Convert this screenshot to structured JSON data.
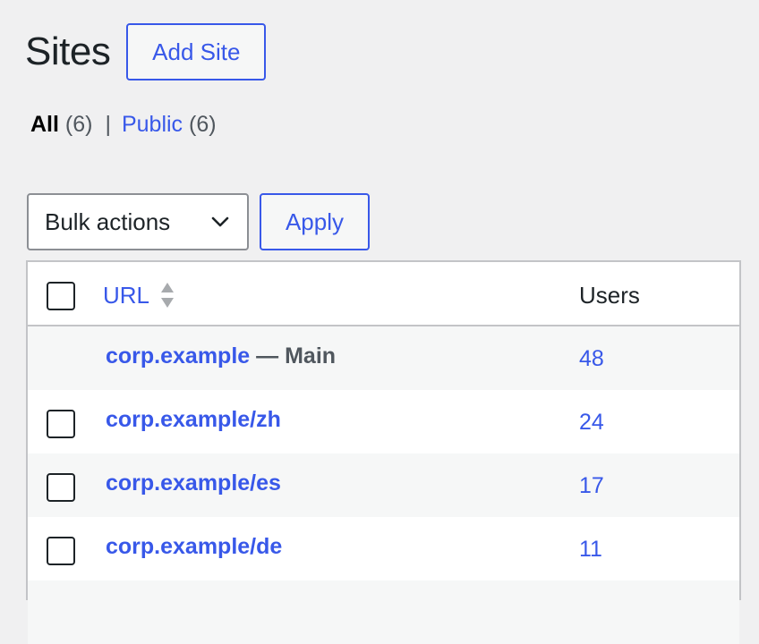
{
  "header": {
    "title": "Sites",
    "add_button_label": "Add Site"
  },
  "filters": [
    {
      "label": "All",
      "count": "(6)",
      "current": true
    },
    {
      "label": "Public",
      "count": "(6)",
      "current": false
    }
  ],
  "filter_separator": "|",
  "bulk_actions": {
    "selected": "Bulk actions",
    "apply_label": "Apply"
  },
  "table": {
    "columns": {
      "url": "URL",
      "users": "Users"
    },
    "rows": [
      {
        "url": "corp.example",
        "suffix": "— Main",
        "users": "48",
        "has_checkbox": false
      },
      {
        "url": "corp.example/zh",
        "suffix": "",
        "users": "24",
        "has_checkbox": true
      },
      {
        "url": "corp.example/es",
        "suffix": "",
        "users": "17",
        "has_checkbox": true
      },
      {
        "url": "corp.example/de",
        "suffix": "",
        "users": "11",
        "has_checkbox": true
      }
    ]
  },
  "colors": {
    "accent": "#3858e9",
    "background": "#f0f0f1",
    "text": "#1d2327",
    "muted": "#50575e",
    "border": "#c3c4c7"
  },
  "icons": {
    "dropdown": "chevron-down-icon",
    "sort": "sort-icon"
  }
}
